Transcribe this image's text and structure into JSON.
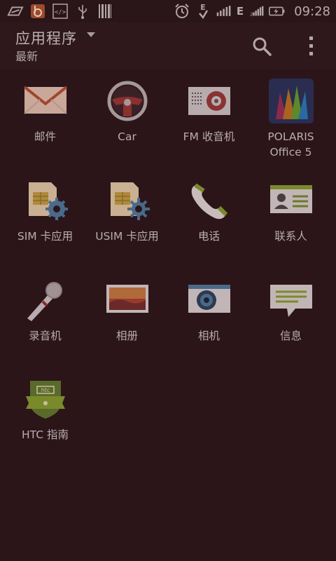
{
  "status_bar": {
    "time": "09:28",
    "network_type_1": "E",
    "network_type_2": "E"
  },
  "action_bar": {
    "title": "应用程序",
    "subtitle": "最新"
  },
  "apps": [
    {
      "label": "邮件",
      "icon": "mail-icon"
    },
    {
      "label": "Car",
      "icon": "steering-wheel-icon"
    },
    {
      "label": "FM 收音机",
      "icon": "radio-icon"
    },
    {
      "label": "POLARIS\nOffice 5",
      "line1": "POLARIS",
      "line2": "Office 5",
      "icon": "polaris-office-icon"
    },
    {
      "label": "SIM 卡应用",
      "icon": "sim-card-icon"
    },
    {
      "label": "USIM 卡应用",
      "icon": "usim-card-icon"
    },
    {
      "label": "电话",
      "icon": "phone-icon"
    },
    {
      "label": "联系人",
      "icon": "contacts-icon"
    },
    {
      "label": "录音机",
      "icon": "microphone-icon"
    },
    {
      "label": "相册",
      "icon": "gallery-icon"
    },
    {
      "label": "相机",
      "icon": "camera-icon"
    },
    {
      "label": "信息",
      "icon": "message-icon"
    },
    {
      "label": "HTC 指南",
      "icon": "htc-guide-icon"
    }
  ],
  "colors": {
    "background": "#2b1519",
    "text": "#b9adaf"
  }
}
